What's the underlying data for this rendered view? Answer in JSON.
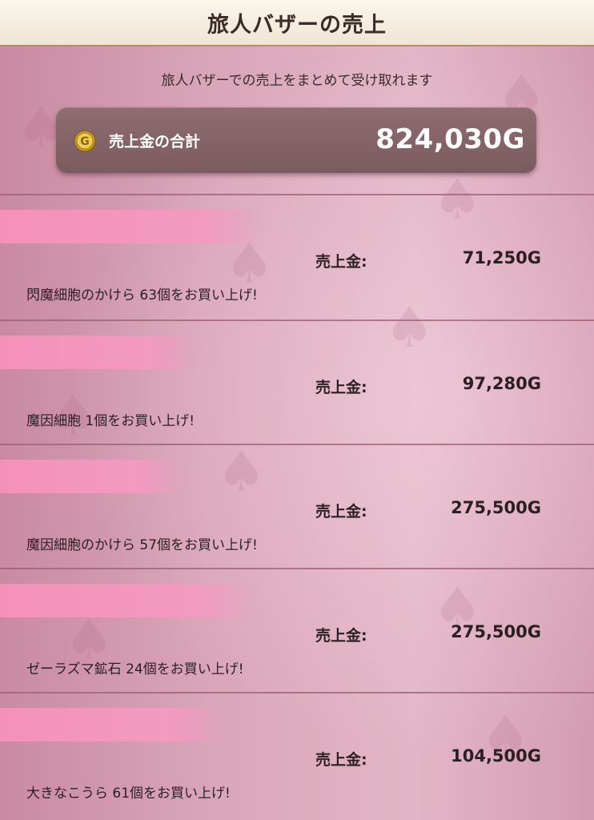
{
  "header": {
    "title": "旅人バザーの売上"
  },
  "summary": {
    "subtitle": "旅人バザーでの売上をまとめて受け取れます",
    "total_label": "売上金の合計",
    "total_value": "824,030G",
    "coin_icon": "gold-coin-icon"
  },
  "sales": [
    {
      "amount_label": "売上金:",
      "amount": "71,250G",
      "description": "閃魔細胞のかけら 63個をお買い上げ!"
    },
    {
      "amount_label": "売上金:",
      "amount": "97,280G",
      "description": "魔因細胞 1個をお買い上げ!"
    },
    {
      "amount_label": "売上金:",
      "amount": "275,500G",
      "description": "魔因細胞のかけら 57個をお買い上げ!"
    },
    {
      "amount_label": "売上金:",
      "amount": "275,500G",
      "description": "ゼーラズマ鉱石 24個をお買い上げ!"
    },
    {
      "amount_label": "売上金:",
      "amount": "104,500G",
      "description": "大きなこうら 61個をお買い上げ!"
    }
  ],
  "colors": {
    "background": "#d7a0b3",
    "total_box": "#7f6064",
    "redaction": "#f491b8",
    "header": "#f6efe2"
  }
}
